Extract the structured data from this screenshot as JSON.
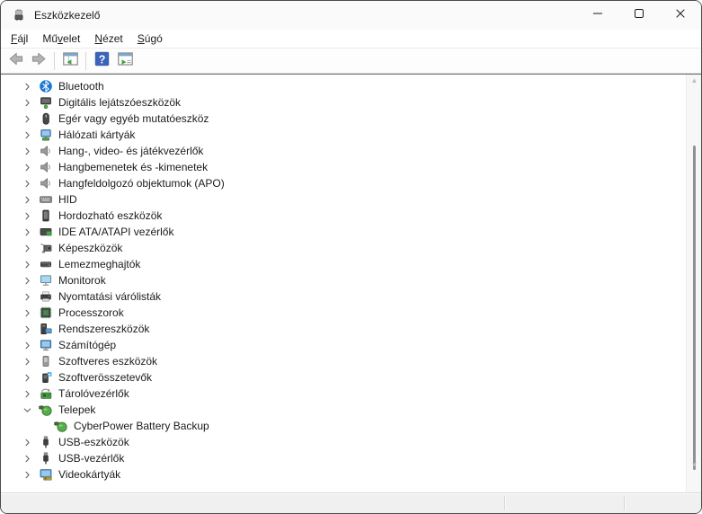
{
  "window": {
    "title": "Eszközkezelő",
    "app_icon": "device-manager-app-icon",
    "controls": [
      {
        "name": "minimize-button",
        "icon": "minimize-icon"
      },
      {
        "name": "maximize-button",
        "icon": "maximize-icon"
      },
      {
        "name": "close-button",
        "icon": "close-icon"
      }
    ]
  },
  "menu": {
    "items": [
      {
        "id": "file",
        "label": "Fájl",
        "access_key_index": 0
      },
      {
        "id": "action",
        "label": "Művelet",
        "access_key_index": 2
      },
      {
        "id": "view",
        "label": "Nézet",
        "access_key_index": 0
      },
      {
        "id": "help",
        "label": "Súgó",
        "access_key_index": 0
      }
    ]
  },
  "toolbar": {
    "items": [
      {
        "type": "button",
        "name": "back-button",
        "icon": "back-arrow-icon",
        "disabled": true
      },
      {
        "type": "button",
        "name": "forward-button",
        "icon": "forward-arrow-icon",
        "disabled": true
      },
      {
        "type": "separator"
      },
      {
        "type": "button",
        "name": "show-hide-console-tree-button",
        "icon": "console-tree-icon",
        "disabled": false
      },
      {
        "type": "separator"
      },
      {
        "type": "button",
        "name": "help-button",
        "icon": "help-icon",
        "disabled": false
      },
      {
        "type": "button",
        "name": "show-hide-action-pane-button",
        "icon": "action-pane-icon",
        "disabled": false
      }
    ]
  },
  "tree": {
    "items": [
      {
        "label": "Bluetooth",
        "icon": "bluetooth-icon",
        "state": "collapsed",
        "level": 0
      },
      {
        "label": "Digitális lejátszóeszközök",
        "icon": "media-player-icon",
        "state": "collapsed",
        "level": 0
      },
      {
        "label": "Egér vagy egyéb mutatóeszköz",
        "icon": "mouse-icon",
        "state": "collapsed",
        "level": 0
      },
      {
        "label": "Hálózati kártyák",
        "icon": "network-adapter-icon",
        "state": "collapsed",
        "level": 0
      },
      {
        "label": "Hang-, video- és játékvezérlők",
        "icon": "speaker-icon",
        "state": "collapsed",
        "level": 0
      },
      {
        "label": "Hangbemenetek és -kimenetek",
        "icon": "speaker-icon",
        "state": "collapsed",
        "level": 0
      },
      {
        "label": "Hangfeldolgozó objektumok (APO)",
        "icon": "speaker-icon",
        "state": "collapsed",
        "level": 0
      },
      {
        "label": "HID",
        "icon": "hid-icon",
        "state": "collapsed",
        "level": 0
      },
      {
        "label": "Hordozható eszközök",
        "icon": "portable-device-icon",
        "state": "collapsed",
        "level": 0
      },
      {
        "label": "IDE ATA/ATAPI vezérlők",
        "icon": "ide-controller-icon",
        "state": "collapsed",
        "level": 0
      },
      {
        "label": "Képeszközök",
        "icon": "imaging-device-icon",
        "state": "collapsed",
        "level": 0
      },
      {
        "label": "Lemezmeghajtók",
        "icon": "disk-drive-icon",
        "state": "collapsed",
        "level": 0
      },
      {
        "label": "Monitorok",
        "icon": "monitor-icon",
        "state": "collapsed",
        "level": 0
      },
      {
        "label": "Nyomtatási várólisták",
        "icon": "printer-icon",
        "state": "collapsed",
        "level": 0
      },
      {
        "label": "Processzorok",
        "icon": "processor-icon",
        "state": "collapsed",
        "level": 0
      },
      {
        "label": "Rendszereszközök",
        "icon": "system-device-icon",
        "state": "collapsed",
        "level": 0
      },
      {
        "label": "Számítógép",
        "icon": "computer-icon",
        "state": "collapsed",
        "level": 0
      },
      {
        "label": "Szoftveres eszközök",
        "icon": "software-device-icon",
        "state": "collapsed",
        "level": 0
      },
      {
        "label": "Szoftverösszetevők",
        "icon": "software-component-icon",
        "state": "collapsed",
        "level": 0
      },
      {
        "label": "Tárolóvezérlők",
        "icon": "storage-controller-icon",
        "state": "collapsed",
        "level": 0
      },
      {
        "label": "Telepek",
        "icon": "battery-icon",
        "state": "expanded",
        "level": 0
      },
      {
        "label": "CyberPower Battery Backup",
        "icon": "battery-icon",
        "state": "leaf",
        "level": 1
      },
      {
        "label": "USB-eszközök",
        "icon": "usb-icon",
        "state": "collapsed",
        "level": 0
      },
      {
        "label": "USB-vezérlők",
        "icon": "usb-icon",
        "state": "collapsed",
        "level": 0
      },
      {
        "label": "Videokártyák",
        "icon": "video-card-icon",
        "state": "collapsed",
        "level": 0
      }
    ]
  },
  "statusbar": {
    "sections": [
      "",
      "",
      ""
    ]
  },
  "colors": {
    "bluetooth_blue": "#1976d2",
    "battery_green": "#57ad4c",
    "help_blue": "#3b63b8",
    "pcb_green": "#4da243",
    "screen_blue": "#5b9fd8",
    "titlebar_bg": "#fafafa",
    "statusbar_bg": "#f0f0f0"
  }
}
